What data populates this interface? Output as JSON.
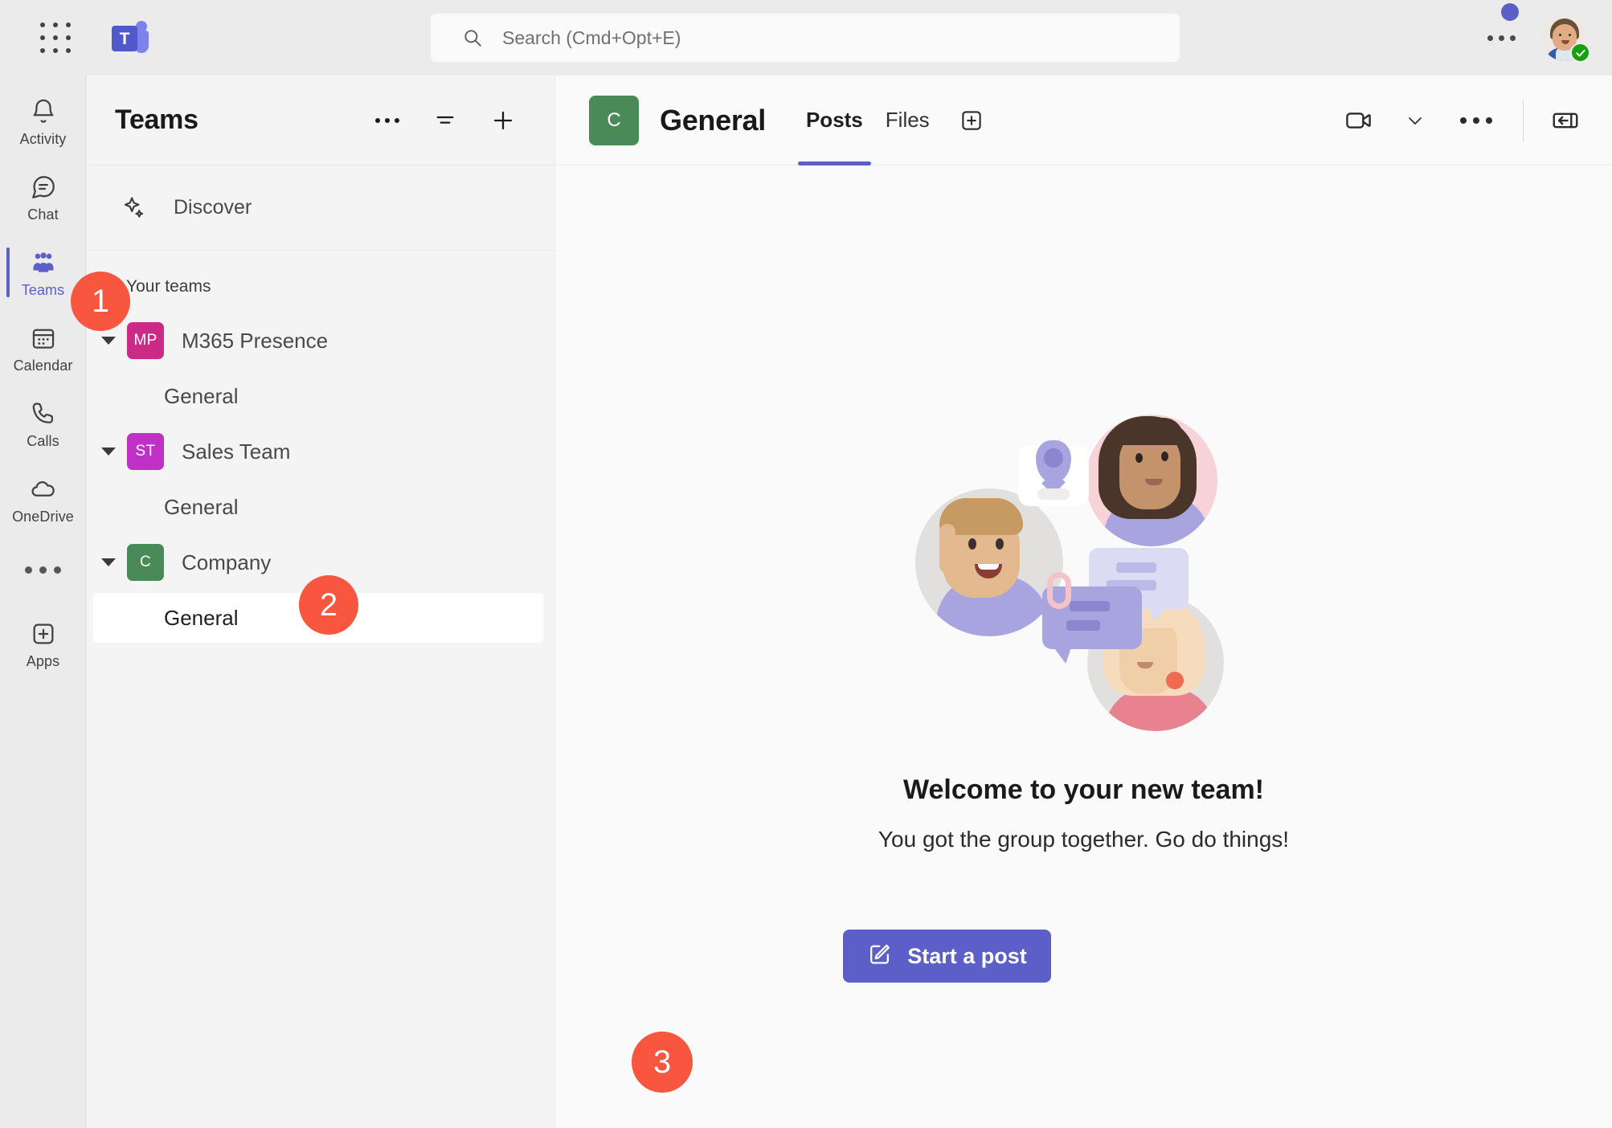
{
  "topbar": {
    "waffle_icon": "grid-apps-icon",
    "logo": {
      "letter": "T",
      "name": "teams-logo"
    },
    "search": {
      "placeholder": "Search (Cmd+Opt+E)",
      "value": "",
      "icon": "search-icon"
    },
    "more_icon": "ellipsis-icon",
    "avatar": {
      "name": "user-avatar",
      "presence": "available",
      "presence_color": "#13A10E"
    },
    "notification_dot_color": "#5B5FC7"
  },
  "rail": {
    "items": [
      {
        "label": "Activity",
        "icon": "bell-icon",
        "selected": false
      },
      {
        "label": "Chat",
        "icon": "chat-bubble-icon",
        "selected": false
      },
      {
        "label": "Teams",
        "icon": "people-icon",
        "selected": true
      },
      {
        "label": "Calendar",
        "icon": "calendar-icon",
        "selected": false
      },
      {
        "label": "Calls",
        "icon": "phone-icon",
        "selected": false
      },
      {
        "label": "OneDrive",
        "icon": "cloud-icon",
        "selected": false
      }
    ],
    "more_icon": "ellipsis-icon",
    "apps": {
      "label": "Apps",
      "icon": "plus-square-icon"
    },
    "accent_color": "#5B5FC7"
  },
  "panel": {
    "title": "Teams",
    "actions": [
      {
        "name": "more-options",
        "icon": "ellipsis-icon"
      },
      {
        "name": "filter",
        "icon": "filter-icon"
      },
      {
        "name": "join-or-create-team",
        "icon": "plus-icon"
      }
    ],
    "discover": {
      "label": "Discover",
      "icon": "sparkle-icon"
    },
    "group_label": "Your teams",
    "teams": [
      {
        "name": "M365 Presence",
        "initials": "MP",
        "color": "#CC2A87",
        "expanded": true,
        "channels": [
          {
            "name": "General",
            "selected": false
          }
        ]
      },
      {
        "name": "Sales Team",
        "initials": "ST",
        "color": "#BF30C7",
        "expanded": true,
        "channels": [
          {
            "name": "General",
            "selected": false
          }
        ]
      },
      {
        "name": "Company",
        "initials": "C",
        "color": "#4A8A58",
        "expanded": true,
        "channels": [
          {
            "name": "General",
            "selected": true
          }
        ]
      }
    ]
  },
  "main": {
    "channel_avatar": {
      "initials": "C",
      "color": "#4A8A58"
    },
    "channel_title": "General",
    "tabs": [
      {
        "label": "Posts",
        "active": true
      },
      {
        "label": "Files",
        "active": false
      }
    ],
    "add_tab_icon": "plus-square-icon",
    "header_actions": [
      {
        "name": "meet-now",
        "icon": "video-camera-icon"
      },
      {
        "name": "meet-now-options",
        "icon": "chevron-down-icon"
      },
      {
        "name": "channel-more-options",
        "icon": "ellipsis-icon"
      },
      {
        "name": "open-chat-panel",
        "icon": "panel-expand-icon"
      }
    ],
    "welcome": {
      "illustration": "team-collaboration-illustration",
      "title": "Welcome to your new team!",
      "subtitle": "You got the group together. Go do things!",
      "start_post_button": {
        "label": "Start a post",
        "icon": "compose-icon",
        "color": "#5B5FC7"
      }
    }
  },
  "annotations": {
    "color": "#F9563F",
    "steps": [
      {
        "number": "1",
        "target": "rail-item-teams"
      },
      {
        "number": "2",
        "target": "channel-general-company"
      },
      {
        "number": "3",
        "target": "start-a-post-button"
      }
    ]
  }
}
